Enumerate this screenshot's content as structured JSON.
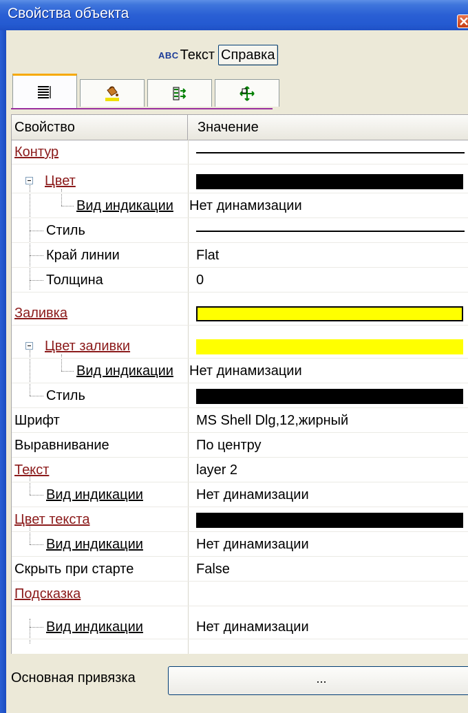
{
  "window": {
    "title": "Свойства объекта"
  },
  "object_type": {
    "icon_text": "ABC",
    "label": "Текст",
    "help_button": "Справка"
  },
  "tabs": [
    {
      "icon": "properties-list-icon",
      "active": true
    },
    {
      "icon": "paint-bucket-icon",
      "active": false
    },
    {
      "icon": "events-icon",
      "active": false
    },
    {
      "icon": "move-icon",
      "active": false
    }
  ],
  "grid": {
    "header": {
      "property": "Свойство",
      "value": "Значение"
    },
    "rows": {
      "contour": {
        "label": "Контур",
        "value_kind": "line"
      },
      "contour_color": {
        "label": "Цвет",
        "value_kind": "swatch",
        "color": "#000000"
      },
      "contour_color_indication": {
        "label": "Вид индикации",
        "value": "Нет динамизации"
      },
      "contour_style": {
        "label": "Стиль",
        "value_kind": "line"
      },
      "line_edge": {
        "label": "Край линии",
        "value": "Flat"
      },
      "thickness": {
        "label": "Толщина",
        "value": "0"
      },
      "fill": {
        "label": "Заливка",
        "value_kind": "swatch",
        "color": "#ffff00"
      },
      "fill_color": {
        "label": "Цвет заливки",
        "value_kind": "swatch",
        "color": "#ffff00"
      },
      "fill_color_indication": {
        "label": "Вид индикации",
        "value": "Нет динамизации"
      },
      "fill_style": {
        "label": "Стиль",
        "value_kind": "swatch",
        "color": "#000000"
      },
      "font": {
        "label": "Шрифт",
        "value": "MS Shell Dlg,12,жирный"
      },
      "alignment": {
        "label": "Выравнивание",
        "value": "По центру"
      },
      "text": {
        "label": "Текст",
        "value": "layer 2"
      },
      "text_indication": {
        "label": "Вид индикации",
        "value": "Нет динамизации"
      },
      "text_color": {
        "label": "Цвет текста",
        "value_kind": "swatch",
        "color": "#000000"
      },
      "text_color_indication": {
        "label": "Вид индикации",
        "value": "Нет динамизации"
      },
      "hide_on_start": {
        "label": "Скрыть при старте",
        "value": "False"
      },
      "tooltip": {
        "label": "Подсказка",
        "value": ""
      },
      "tooltip_indication": {
        "label": "Вид индикации",
        "value": "Нет динамизации"
      }
    }
  },
  "binding": {
    "label": "Основная привязка",
    "button": "..."
  }
}
